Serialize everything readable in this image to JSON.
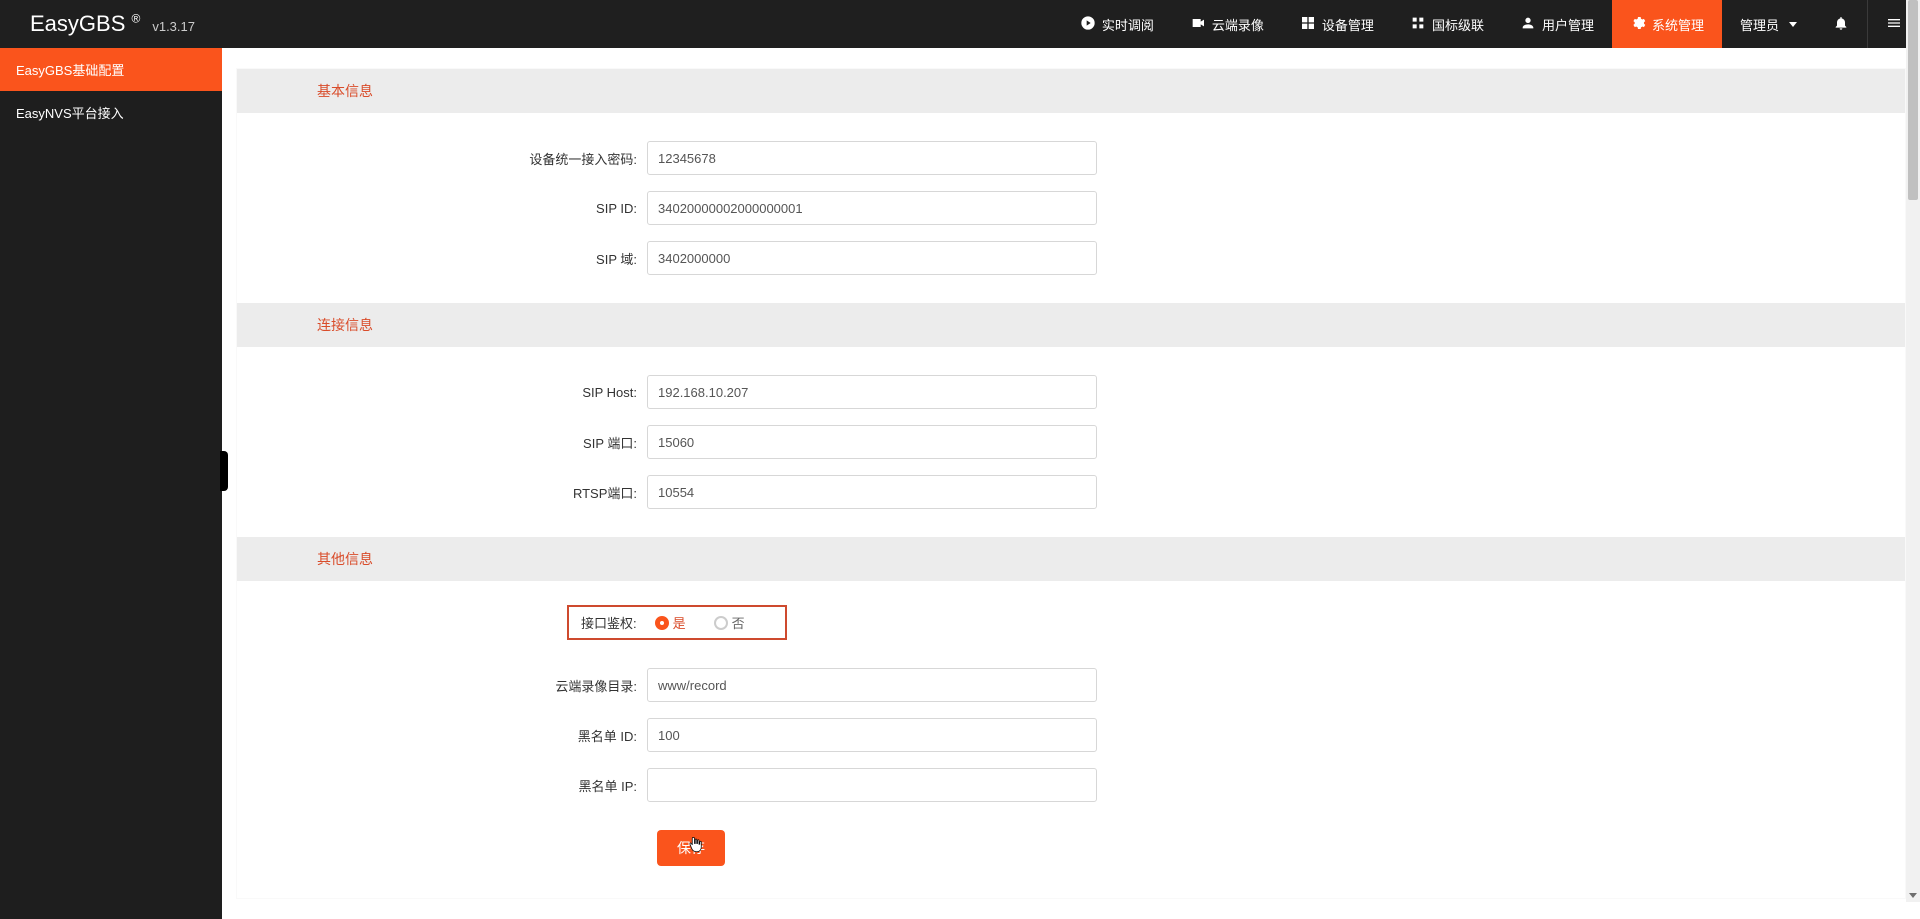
{
  "brand": {
    "name": "EasyGBS",
    "reg": "®",
    "version": "v1.3.17"
  },
  "topnav": {
    "items": [
      {
        "label": "实时调阅"
      },
      {
        "label": "云端录像"
      },
      {
        "label": "设备管理"
      },
      {
        "label": "国标级联"
      },
      {
        "label": "用户管理"
      },
      {
        "label": "系统管理"
      }
    ],
    "user_label": "管理员"
  },
  "sidebar": {
    "items": [
      {
        "label": "EasyGBS基础配置"
      },
      {
        "label": "EasyNVS平台接入"
      }
    ]
  },
  "sections": {
    "basic": {
      "title": "基本信息",
      "fields": {
        "device_pwd_label": "设备统一接入密码:",
        "device_pwd_value": "12345678",
        "sip_id_label": "SIP ID:",
        "sip_id_value": "34020000002000000001",
        "sip_domain_label": "SIP 域:",
        "sip_domain_value": "3402000000"
      }
    },
    "conn": {
      "title": "连接信息",
      "fields": {
        "sip_host_label": "SIP Host:",
        "sip_host_value": "192.168.10.207",
        "sip_port_label": "SIP 端口:",
        "sip_port_value": "15060",
        "rtsp_port_label": "RTSP端口:",
        "rtsp_port_value": "10554"
      }
    },
    "other": {
      "title": "其他信息",
      "fields": {
        "auth_label": "接口鉴权:",
        "auth_yes": "是",
        "auth_no": "否",
        "record_dir_label": "云端录像目录:",
        "record_dir_value": "www/record",
        "blacklist_id_label": "黑名单 ID:",
        "blacklist_id_value": "100",
        "blacklist_ip_label": "黑名单 IP:",
        "blacklist_ip_value": ""
      }
    }
  },
  "buttons": {
    "save": "保存"
  }
}
